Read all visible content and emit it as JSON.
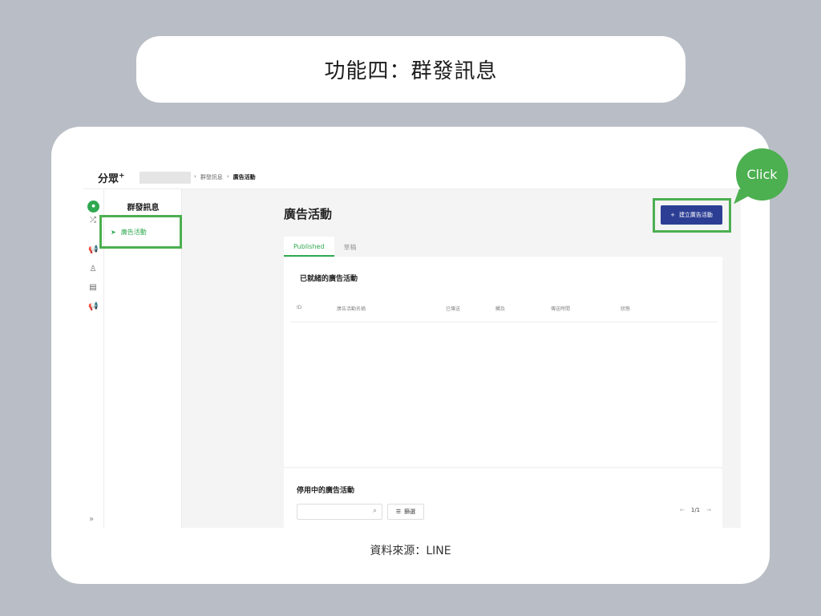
{
  "slide": {
    "title": "功能四：群發訊息",
    "source": "資料來源：LINE",
    "callout": "Click"
  },
  "app": {
    "logo": "分眾",
    "logo_sup": "+",
    "breadcrumbs": [
      "群發訊息",
      "廣告活動"
    ],
    "rail": {
      "avatar": "avatar",
      "icons": [
        "shuffle-icon",
        "megaphone-icon",
        "user-icon",
        "table-icon",
        "megaphone-icon"
      ],
      "expand": "»"
    },
    "sidenav": {
      "title": "群發訊息",
      "item": "廣告活動"
    },
    "main": {
      "title": "廣告活動",
      "create_button": "建立廣告活動",
      "tabs": [
        {
          "label": "Published",
          "active": true
        },
        {
          "label": "草稿",
          "active": false
        }
      ],
      "published_panel": {
        "title": "已就緒的廣告活動",
        "columns": [
          "ID",
          "廣告活動名稱",
          "已傳送",
          "觸及",
          "傳送時間",
          "狀態"
        ]
      },
      "paused_panel": {
        "title": "停用中的廣告活動",
        "search_placeholder": "",
        "filter_label": "篩選",
        "page": "1/1"
      }
    }
  },
  "colors": {
    "accent_green": "#4caf50",
    "primary_button": "#2c3e94",
    "backdrop": "#b9bec6"
  }
}
